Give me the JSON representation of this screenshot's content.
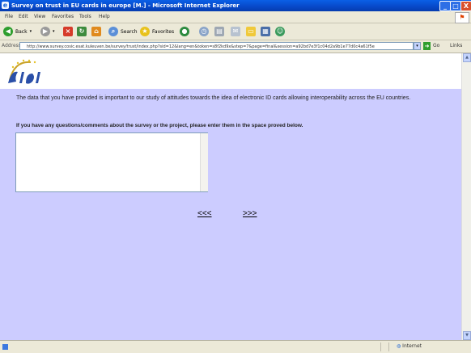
{
  "window": {
    "title": "Survey on trust in EU cards in europe [M.] - Microsoft Internet Explorer",
    "buttons": {
      "minimize": "_",
      "maximize": "□",
      "close": "X"
    }
  },
  "menu": {
    "items": [
      "File",
      "Edit",
      "View",
      "Favorites",
      "Tools",
      "Help"
    ]
  },
  "toolbar": {
    "back": "Back",
    "search": "Search",
    "favorites": "Favorites"
  },
  "address": {
    "label": "Address",
    "url": "http://www.survey.cosic.esat.kuleuven.be/survey/trust/index.php?sid=12&lang=en&token=s8f2kd9x&step=7&page=final&session=a92bd7e3f1c04d2a9b1e77d0c4a61f5e",
    "go": "Go",
    "links": "Links"
  },
  "page": {
    "intro": "The data that you have provided is important to our study of attitudes towards the idea of electronic ID cards allowing interoperability across the EU countries.",
    "question": "If you have any questions/comments about the survey or the project, please enter them in the space proved below.",
    "comments_value": "",
    "prev_label": "<<<",
    "next_label": ">>>"
  },
  "status": {
    "zone": "Internet"
  },
  "colors": {
    "page_background": "#ccccff",
    "titlebar": "#0a5fe6"
  }
}
